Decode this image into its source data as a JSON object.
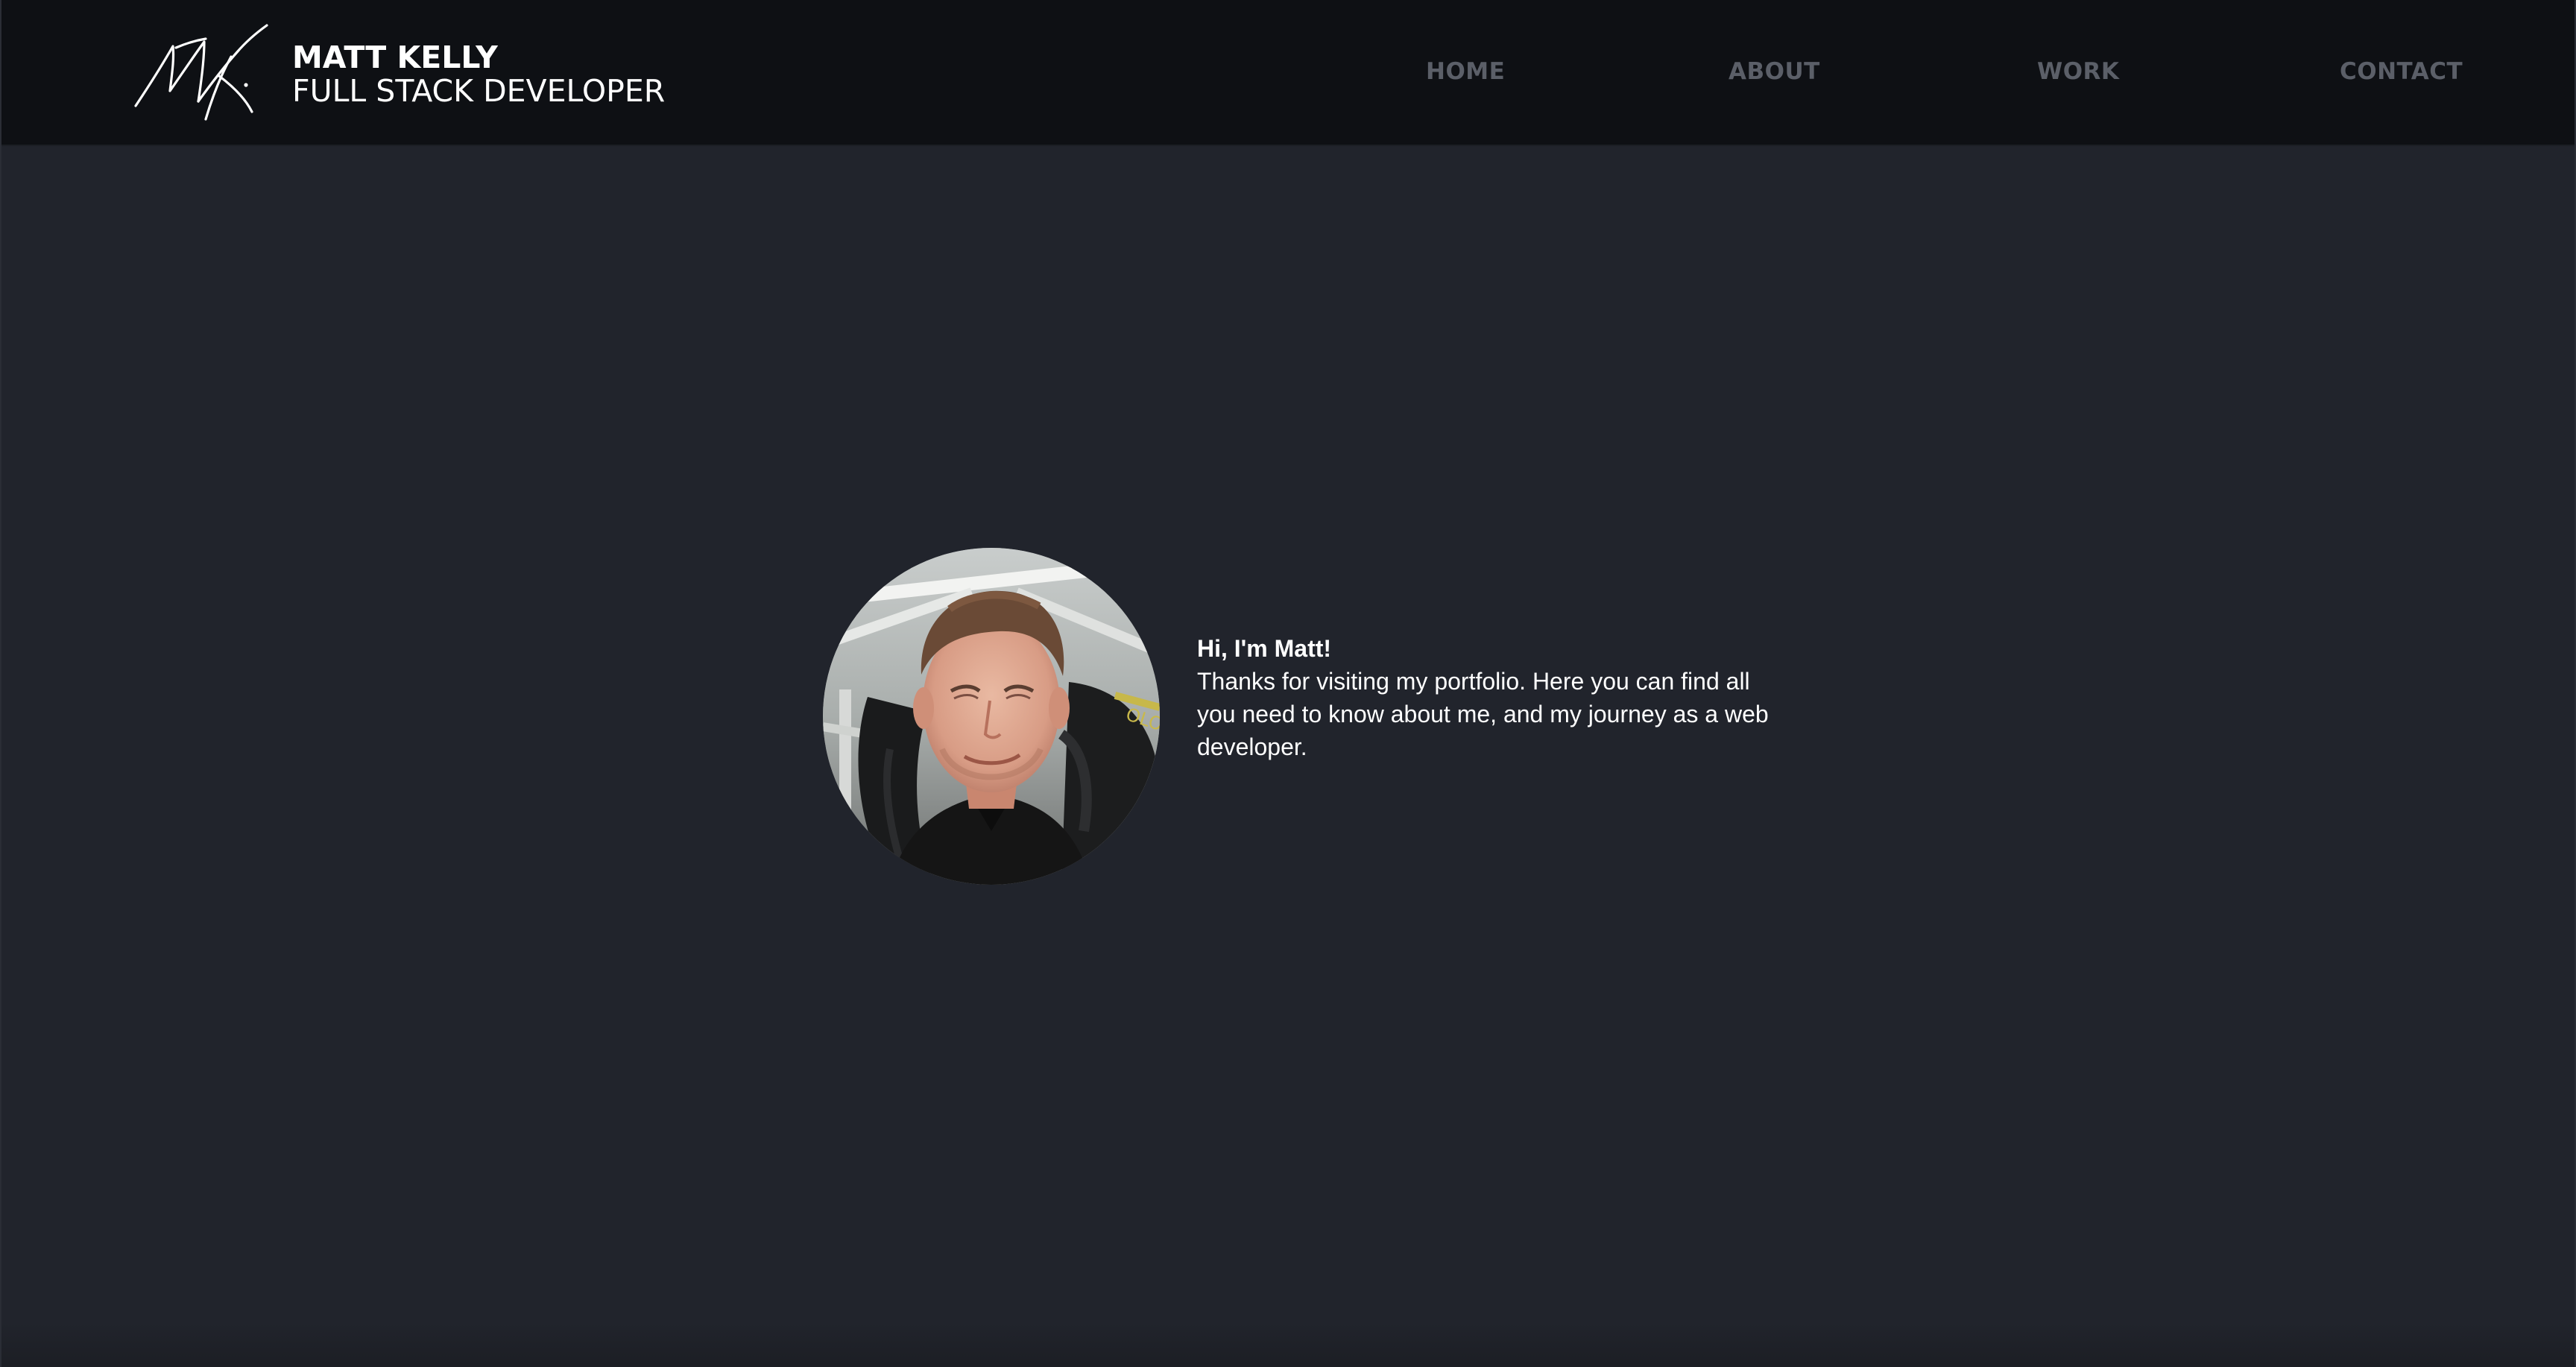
{
  "header": {
    "brand": {
      "logo_icon": "signature-logo-icon",
      "name": "MATT KELLY",
      "role": "FULL STACK DEVELOPER"
    },
    "nav": [
      {
        "label": "HOME"
      },
      {
        "label": "ABOUT"
      },
      {
        "label": "WORK"
      },
      {
        "label": "CONTACT"
      }
    ]
  },
  "intro": {
    "avatar_icon": "profile-photo",
    "heading": "Hi, I'm Matt!",
    "body": "Thanks for visiting my portfolio. Here you can find all you need to know about me, and my journey as a web developer."
  },
  "colors": {
    "background": "#21242c",
    "header_background": "#0e1014",
    "nav_text": "#5b5f68",
    "text": "#ffffff"
  }
}
